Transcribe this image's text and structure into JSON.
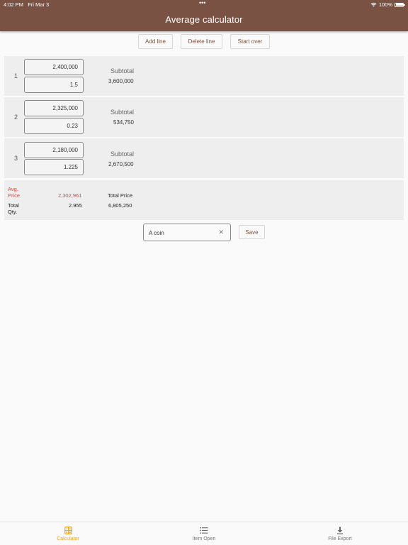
{
  "status_bar": {
    "time": "4:02 PM",
    "date": "Fri Mar 3",
    "battery": "100%"
  },
  "app": {
    "title": "Average calculator",
    "bar_color": "#7a5244",
    "accent": "#f0a020"
  },
  "toolbar": {
    "add_line": "Add line",
    "delete_line": "Delete line",
    "start_over": "Start over"
  },
  "lines": [
    {
      "number": "1",
      "price": "2,400,000",
      "qty": "1.5",
      "subtotal_label": "Subtotal",
      "subtotal": "3,600,000"
    },
    {
      "number": "2",
      "price": "2,325,000",
      "qty": "0.23",
      "subtotal_label": "Subtotal",
      "subtotal": "534,750"
    },
    {
      "number": "3",
      "price": "2,180,000",
      "qty": "1.225",
      "subtotal_label": "Subtotal",
      "subtotal": "2,670,500"
    }
  ],
  "summary": {
    "avg_price_label_1": "Avg.",
    "avg_price_label_2": "Price",
    "avg_price": "2,302,961",
    "total_qty_label_1": "Total",
    "total_qty_label_2": "Qty.",
    "total_qty": "2.955",
    "total_price_label": "Total Price",
    "total_price": "6,805,250"
  },
  "save_form": {
    "name_value": "A coin",
    "save_label": "Save"
  },
  "bottom_nav": [
    {
      "label": "Calculator",
      "icon": "calculator-icon",
      "active": true
    },
    {
      "label": "Item Open",
      "icon": "list-icon",
      "active": false
    },
    {
      "label": "File Export",
      "icon": "download-icon",
      "active": false
    }
  ]
}
